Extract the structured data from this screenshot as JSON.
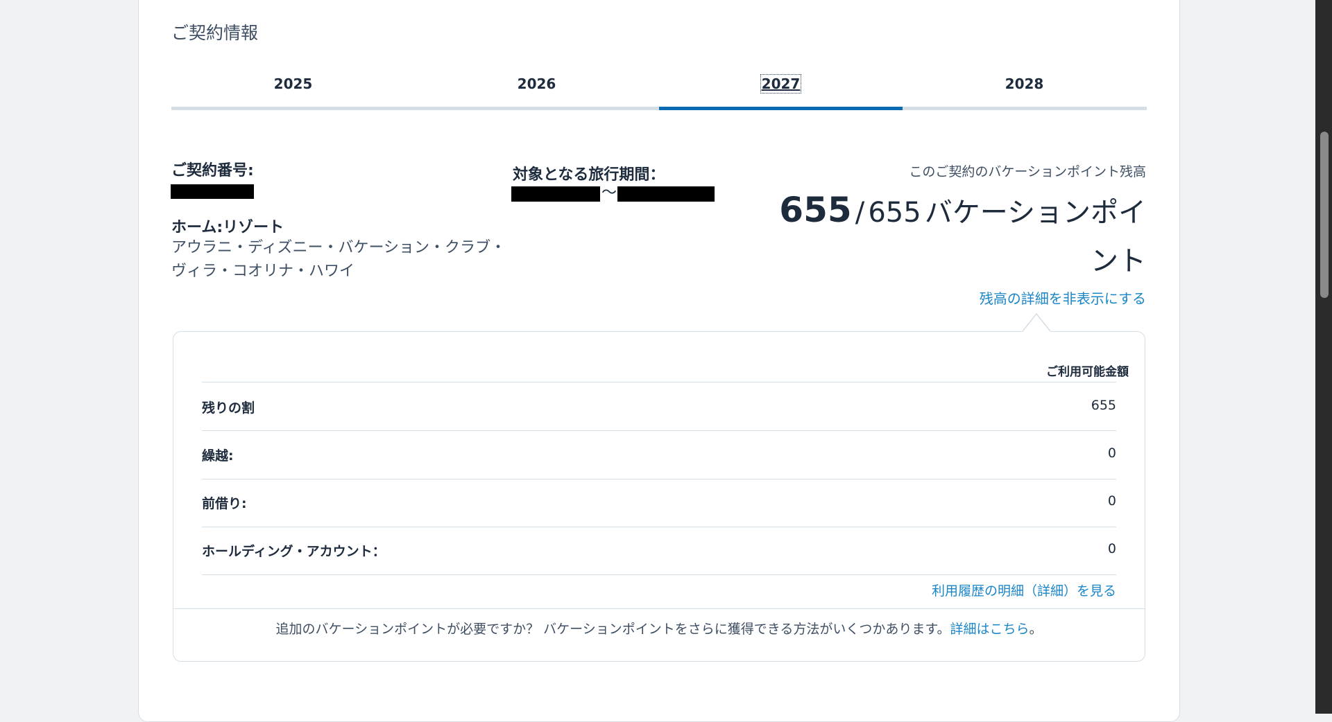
{
  "section": {
    "title": "ご契約情報"
  },
  "tabs": [
    {
      "label": "2025",
      "active": false
    },
    {
      "label": "2026",
      "active": false
    },
    {
      "label": "2027",
      "active": true
    },
    {
      "label": "2028",
      "active": false
    }
  ],
  "contract": {
    "number_label": "ご契約番号:",
    "home_resort_label": "ホーム:リゾート",
    "home_resort_line1": "アウラニ・ディズニー・バケーション・クラブ・",
    "home_resort_line2": "ヴィラ・コオリナ・ハワイ",
    "travel_period_label": "対象となる旅行期間：",
    "travel_period_separator": "〜"
  },
  "balance": {
    "caption": "このご契約のバケーションポイント残高",
    "remaining": "655",
    "separator": "/",
    "total": "655",
    "unit": "バケーションポイント",
    "toggle_link": "残高の詳細を非表示にする"
  },
  "details": {
    "column_header": "ご利用可能金額",
    "rows": [
      {
        "label": "残りの割",
        "value": "655"
      },
      {
        "label": "繰越:",
        "value": "0"
      },
      {
        "label": "前借り:",
        "value": "0"
      },
      {
        "label": "ホールディング・アカウント：",
        "value": "0"
      }
    ],
    "history_link": "利用履歴の明細（詳細）を見る",
    "footer_text": "追加のバケーションポイントが必要ですか？ バケーションポイントをさらに獲得できる方法がいくつかあります。",
    "footer_link": "詳細はこちら",
    "footer_end": "。"
  },
  "colors": {
    "accent": "#0a6bb3",
    "link": "#1b86c7",
    "text_dark": "#1d2b3d"
  }
}
